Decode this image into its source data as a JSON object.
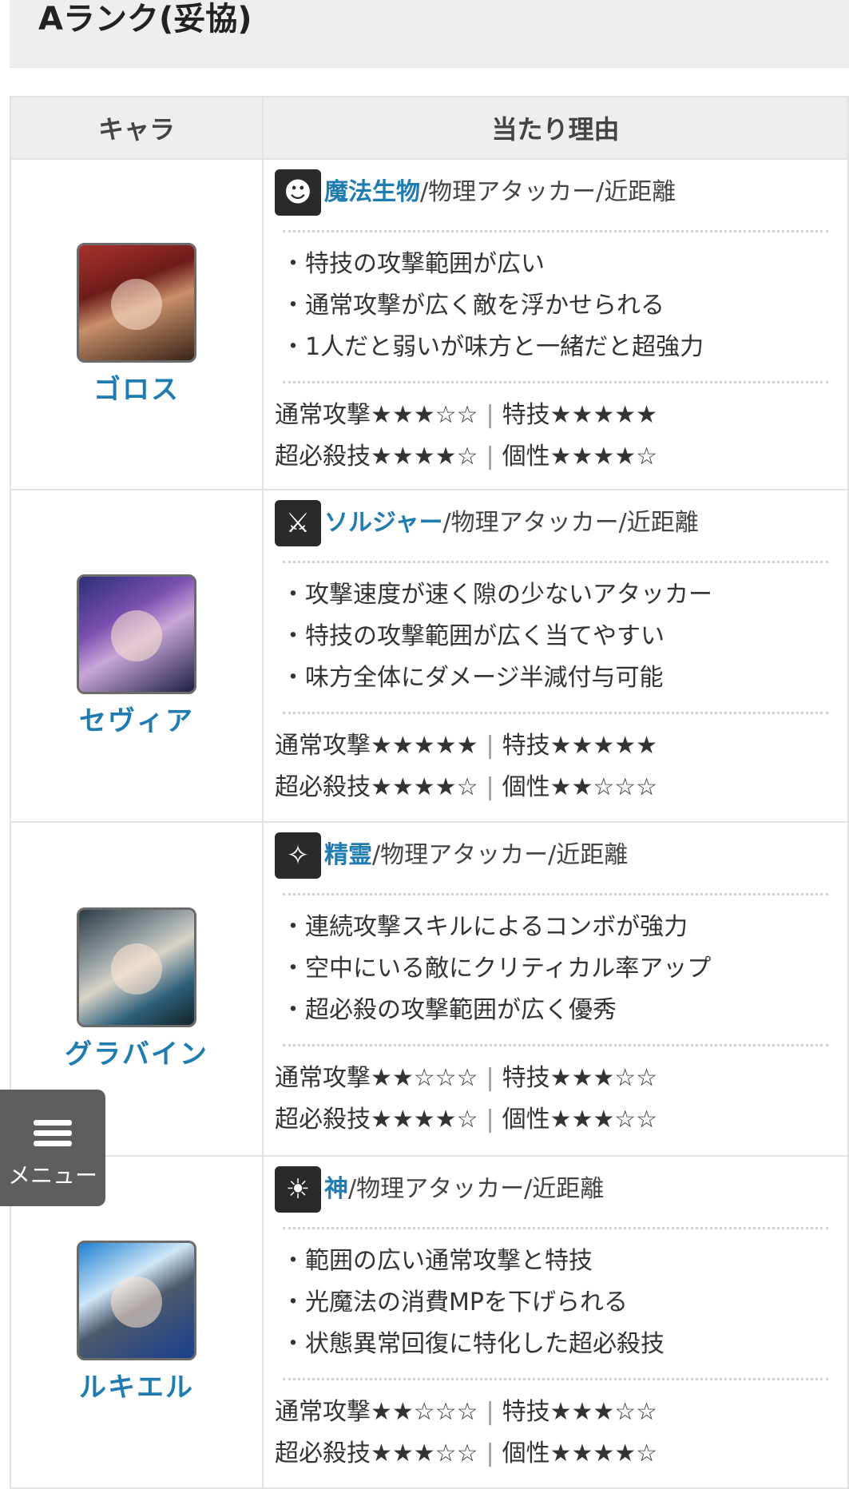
{
  "section": {
    "title": "Aランク(妥協)"
  },
  "table": {
    "headers": [
      "キャラ",
      "当たり理由"
    ],
    "rows": [
      {
        "name": "ゴロス",
        "type_link": "魔法生物",
        "type_rest": "/物理アタッカー/近距離",
        "points": [
          "特技の攻撃範囲が広い",
          "通常攻撃が広く敵を浮かせられる",
          "1人だと弱いが味方と一緒だと超強力"
        ],
        "ratings_line1": {
          "a": "通常攻撃★★★☆☆",
          "b": "特技★★★★★"
        },
        "ratings_line2": {
          "a": "超必殺技★★★★☆",
          "b": "個性★★★★☆"
        }
      },
      {
        "name": "セヴィア",
        "type_link": "ソルジャー",
        "type_rest": "/物理アタッカー/近距離",
        "points": [
          "攻撃速度が速く隙の少ないアタッカー",
          "特技の攻撃範囲が広く当てやすい",
          "味方全体にダメージ半減付与可能"
        ],
        "ratings_line1": {
          "a": "通常攻撃★★★★★",
          "b": "特技★★★★★"
        },
        "ratings_line2": {
          "a": "超必殺技★★★★☆",
          "b": "個性★★☆☆☆"
        }
      },
      {
        "name": "グラバイン",
        "type_link": "精霊",
        "type_rest": "/物理アタッカー/近距離",
        "points": [
          "連続攻撃スキルによるコンボが強力",
          "空中にいる敵にクリティカル率アップ",
          "超必殺の攻撃範囲が広く優秀"
        ],
        "ratings_line1": {
          "a": "通常攻撃★★☆☆☆",
          "b": "特技★★★☆☆"
        },
        "ratings_line2": {
          "a": "超必殺技★★★★☆",
          "b": "個性★★★☆☆"
        }
      },
      {
        "name": "ルキエル",
        "type_link": "神",
        "type_rest": "/物理アタッカー/近距離",
        "points": [
          "範囲の広い通常攻撃と特技",
          "光魔法の消費MPを下げられる",
          "状態異常回復に特化した超必殺技"
        ],
        "ratings_line1": {
          "a": "通常攻撃★★☆☆☆",
          "b": "特技★★★☆☆"
        },
        "ratings_line2": {
          "a": "超必殺技★★★☆☆",
          "b": "個性★★★★☆"
        }
      }
    ],
    "separator": "|"
  },
  "menu": {
    "label": "メニュー",
    "icon": "hamburger-menu-icon"
  },
  "colors": {
    "link": "#1f7bb0",
    "header_bg": "#eeeeee",
    "border": "#e2e2e2"
  }
}
